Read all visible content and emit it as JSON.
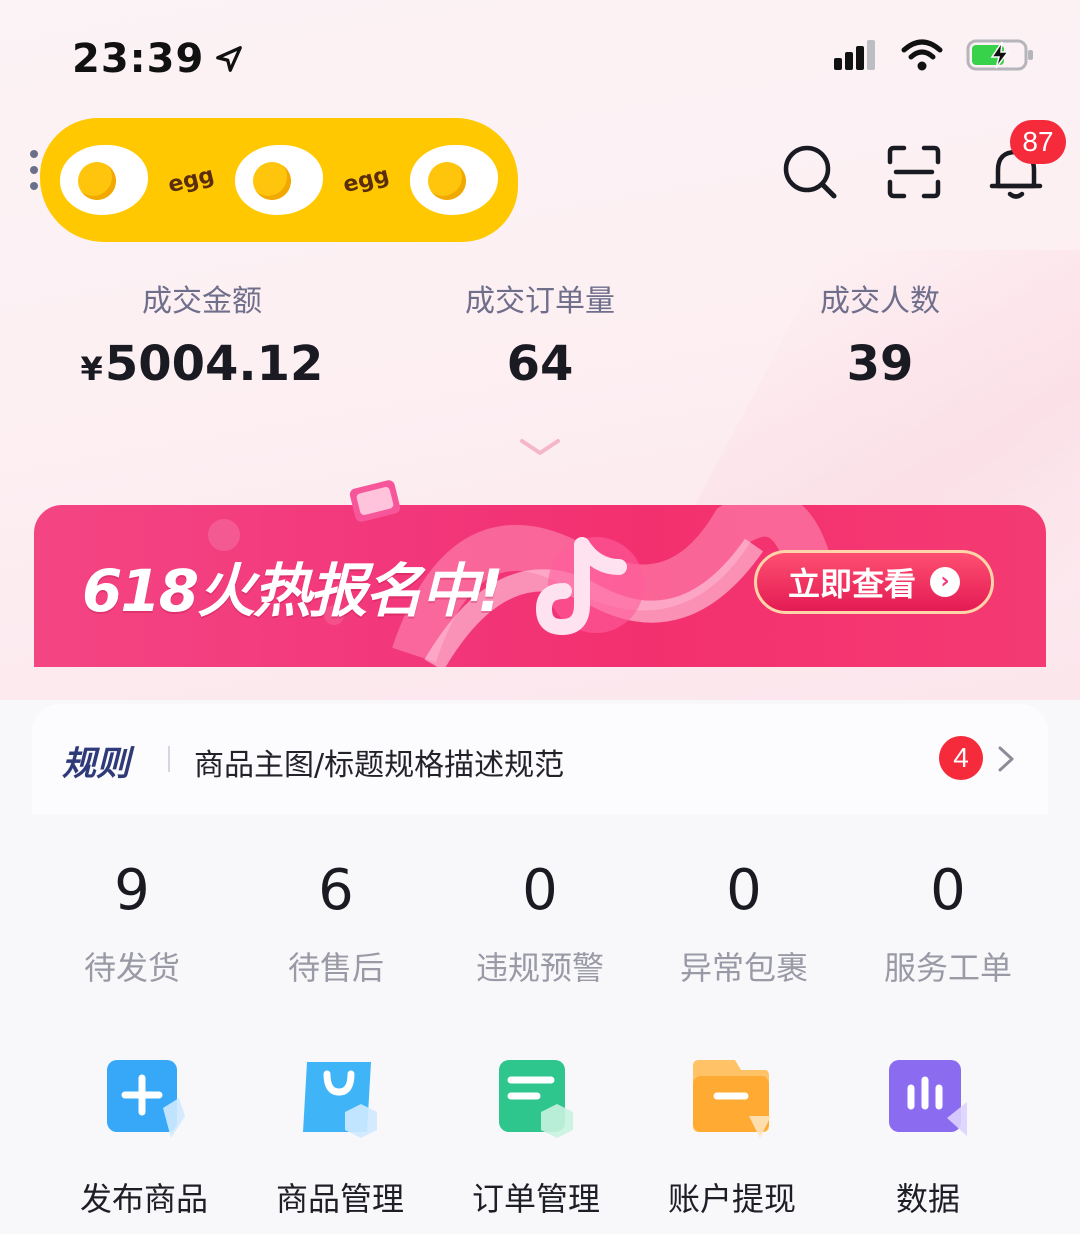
{
  "status_bar": {
    "time": "23:39",
    "icons": [
      "location-arrow-icon",
      "cellular-signal-icon",
      "wifi-icon",
      "battery-charging-icon"
    ]
  },
  "header": {
    "store_banner_texts": [
      "egg",
      "egg"
    ],
    "notification_count": "87",
    "icons": [
      "menu-dots-icon",
      "search-icon",
      "scan-icon",
      "bell-icon"
    ]
  },
  "stats": [
    {
      "label": "成交金额",
      "prefix": "¥",
      "value": "5004.12"
    },
    {
      "label": "成交订单量",
      "prefix": "",
      "value": "64"
    },
    {
      "label": "成交人数",
      "prefix": "",
      "value": "39"
    }
  ],
  "promo": {
    "headline": "618火热报名中!",
    "button_label": "立即查看",
    "colors": {
      "primary": "#f23679",
      "button_border": "#ffd4a8"
    }
  },
  "rules": {
    "title": "规则",
    "text": "商品主图/标题规格描述规范",
    "badge": "4"
  },
  "counters": [
    {
      "value": "9",
      "label": "待发货"
    },
    {
      "value": "6",
      "label": "待售后"
    },
    {
      "value": "0",
      "label": "违规预警"
    },
    {
      "value": "0",
      "label": "异常包裹"
    },
    {
      "value": "0",
      "label": "服务工单"
    }
  ],
  "tools": [
    {
      "label": "发布商品",
      "icon": "publish-plus-icon",
      "color": "#36a8f7"
    },
    {
      "label": "商品管理",
      "icon": "shopping-bag-icon",
      "color": "#3fb5f8"
    },
    {
      "label": "订单管理",
      "icon": "order-list-icon",
      "color": "#2fc68d"
    },
    {
      "label": "账户提现",
      "icon": "wallet-folder-icon",
      "color": "#ffaa33"
    },
    {
      "label": "数据",
      "icon": "bar-chart-icon",
      "color": "#8b6cf0"
    }
  ]
}
